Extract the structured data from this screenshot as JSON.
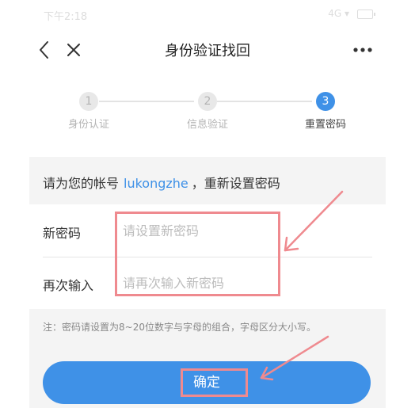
{
  "status_bar": {
    "time": "下午2:18",
    "signal": "4G ▾"
  },
  "header": {
    "title": "身份验证找回"
  },
  "steps": [
    {
      "number": "1",
      "label": "身份认证",
      "state": "done"
    },
    {
      "number": "2",
      "label": "信息验证",
      "state": "done"
    },
    {
      "number": "3",
      "label": "重置密码",
      "state": "active"
    }
  ],
  "account": {
    "prefix": "请为您的帐号",
    "username": "lukongzhe",
    "suffix": "，重新设置密码"
  },
  "form": {
    "new_password": {
      "label": "新密码",
      "placeholder": "请设置新密码",
      "value": ""
    },
    "confirm_password": {
      "label": "再次输入",
      "placeholder": "请再次输入新密码",
      "value": ""
    }
  },
  "note": "注：密码请设置为8~20位数字与字母的组合，字母区分大小写。",
  "confirm_button": {
    "label": "确定"
  },
  "colors": {
    "accent": "#3f91e7",
    "annotation": "#ef8a8f",
    "background": "#f4f4f4"
  }
}
